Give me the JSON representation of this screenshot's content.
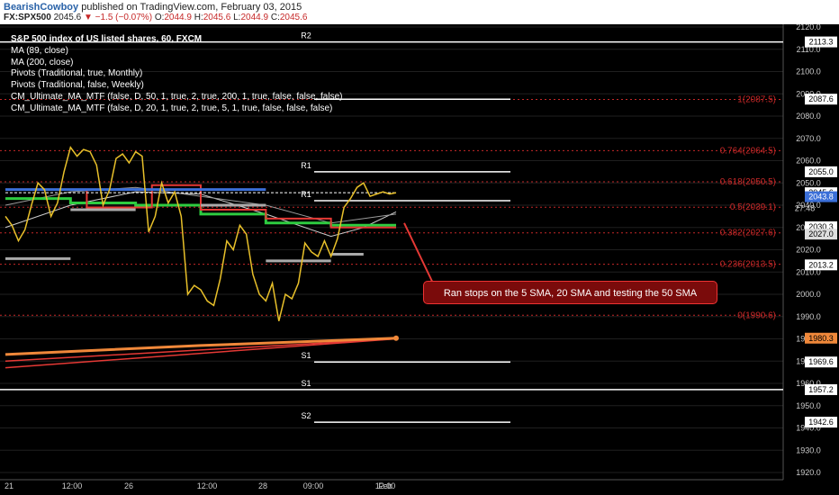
{
  "header": {
    "author": "BearishCowboy",
    "published": "published on TradingView.com, February 03, 2015",
    "symbol": "FX:SPX500",
    "last": "2045.6",
    "change": "−1.5 (−0.07%)",
    "open_label": "O:",
    "open": "2044.9",
    "high_label": "H:",
    "high": "2045.6",
    "low_label": "L:",
    "low": "2044.9",
    "close_label": "C:",
    "close": "2045.6"
  },
  "legend": {
    "title": "S&P 500 index of US listed shares, 60, FXCM",
    "items": [
      "MA (89, close)",
      "MA (200, close)",
      "Pivots (Traditional, true, Monthly)",
      "Pivots (Traditional, false, Weekly)",
      "CM_Ultimate_MA_MTF (false, D, 50, 1, true, 2, true, 200, 1, true, false, false, false)",
      "CM_Ultimate_MA_MTF (false, D, 20, 1, true, 2, true, 5, 1, true, false, false, false)"
    ]
  },
  "annotation": "Ran stops on the 5 SMA, 20 SMA and testing the 50 SMA",
  "colors": {
    "price": "#e8c02a",
    "fib": "#c62828",
    "pivot": "#ffffff",
    "ma50": "#f0883a",
    "ma20": "#2ecc40",
    "ma5": "#e53935",
    "ma200": "#cccccc",
    "grid": "#666666"
  },
  "chart_data": {
    "type": "line",
    "y_ticks": [
      1920,
      1930,
      1940,
      1950,
      1960,
      1970,
      1980,
      1990,
      2000,
      2010,
      2020,
      2030,
      2040,
      2050,
      2060,
      2070,
      2080,
      2090,
      2100,
      2110,
      2120
    ],
    "ylim": [
      1920,
      2120
    ],
    "x_ticks": [
      "21",
      "12:00",
      "26",
      "12:00",
      "28",
      "09:00",
      "Feb",
      "12:00"
    ],
    "grid": true,
    "price": {
      "name": "SPX500",
      "x": [
        0,
        2,
        4,
        6,
        8,
        10,
        12,
        14,
        16,
        18,
        20,
        22,
        24,
        26,
        28,
        30,
        32,
        34,
        36,
        38,
        40,
        42,
        44,
        46,
        48,
        50,
        52,
        54,
        56,
        58,
        60,
        62,
        64,
        66,
        68,
        70,
        72,
        74,
        76,
        78,
        80,
        82,
        84,
        86,
        88,
        90,
        92,
        94,
        96,
        98,
        100,
        102,
        104,
        106,
        108,
        110,
        112,
        114,
        116,
        118,
        120
      ],
      "values": [
        2035,
        2031,
        2024,
        2029,
        2040,
        2050,
        2047,
        2035,
        2041,
        2055,
        2066,
        2062,
        2065,
        2064,
        2058,
        2040,
        2047,
        2061,
        2063,
        2059,
        2064,
        2062,
        2028,
        2035,
        2050,
        2041,
        2046,
        2035,
        2000,
        2004,
        2002,
        1997,
        1995,
        2007,
        2024,
        2020,
        2031,
        2027,
        2009,
        2000,
        1997,
        2005,
        1988,
        2000,
        1998,
        2005,
        2023,
        2019,
        2017,
        2024,
        2017,
        2025,
        2039,
        2043,
        2048,
        2050,
        2044,
        2045,
        2046,
        2045,
        2045.6
      ]
    },
    "fib_levels": [
      {
        "label": "1(2087.5)",
        "value": 2087.5
      },
      {
        "label": "0.764(2064.5)",
        "value": 2064.5
      },
      {
        "label": "0.618(2050.5)",
        "value": 2050.5
      },
      {
        "label": "0.5(2039.1)",
        "value": 2039.1
      },
      {
        "label": "0.382(2027.6)",
        "value": 2027.6
      },
      {
        "label": "0.236(2013.5)",
        "value": 2013.5
      },
      {
        "label": "0(1990.6)",
        "value": 1990.6
      }
    ],
    "pivot_lines": [
      {
        "label": "R2",
        "value": 2113.3
      },
      {
        "label": "",
        "value": 2087.6
      },
      {
        "label": "R1",
        "value": 2055.0
      },
      {
        "label": "R1",
        "value": 2042.0
      },
      {
        "label": "S1",
        "value": 1969.6
      },
      {
        "label": "S1",
        "value": 1957.2
      },
      {
        "label": "S2",
        "value": 1942.6
      }
    ],
    "price_badges": [
      {
        "value": 2113.3,
        "text": "2113.3"
      },
      {
        "value": 2087.6,
        "text": "2087.6"
      },
      {
        "value": 2055.0,
        "text": "2055.0"
      },
      {
        "value": 2045.6,
        "text": "2045.6"
      },
      {
        "value": 2043.8,
        "text": "2043.8"
      },
      {
        "value": 2030.3,
        "text": "2030.3"
      },
      {
        "value": 2027.0,
        "text": "2027.0"
      },
      {
        "value": 2013.2,
        "text": "2013.2"
      },
      {
        "value": 1980.3,
        "text": "1980.3"
      },
      {
        "value": 1969.6,
        "text": "1969.6"
      },
      {
        "value": 1957.2,
        "text": "1957.2"
      },
      {
        "value": 1942.6,
        "text": "1942.6"
      }
    ],
    "countdown": "27:48",
    "ma50_line": {
      "name": "50 SMA",
      "x": [
        0,
        60,
        120
      ],
      "values": [
        1973,
        1977,
        1980.3
      ]
    },
    "red_trend": {
      "x": [
        0,
        120
      ],
      "values": [
        1970,
        1980
      ]
    }
  }
}
